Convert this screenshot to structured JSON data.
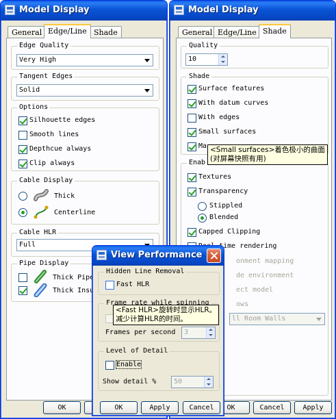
{
  "left_dialog": {
    "title": "Model Display",
    "tabs": [
      "General",
      "Edge/Line",
      "Shade"
    ],
    "edge_quality": {
      "label": "Edge Quality",
      "value": "Very High"
    },
    "tangent_edges": {
      "label": "Tangent Edges",
      "value": "Solid"
    },
    "options": {
      "label": "Options",
      "items": [
        {
          "label": "Silhouette edges",
          "checked": true
        },
        {
          "label": "Smooth lines",
          "checked": false
        },
        {
          "label": "Depthcue always",
          "checked": true
        },
        {
          "label": "Clip always",
          "checked": true
        }
      ]
    },
    "cable_display": {
      "label": "Cable Display",
      "thick": "Thick",
      "centerline": "Centerline",
      "selected": "Centerline"
    },
    "cable_hlr": {
      "label": "Cable HLR",
      "value": "Full"
    },
    "pipe_display": {
      "label": "Pipe Display",
      "thick_pipes": "Thick Pipe",
      "thick_insulation": "Thick Insu"
    },
    "ok": "OK"
  },
  "right_dialog": {
    "title": "Model Display",
    "tabs": [
      "General",
      "Edge/Line",
      "Shade"
    ],
    "quality": {
      "label": "Quality",
      "value": "10"
    },
    "shade": {
      "label": "Shade",
      "items": [
        {
          "label": "Surface features",
          "checked": true
        },
        {
          "label": "With datum curves",
          "checked": true
        },
        {
          "label": "With edges",
          "checked": false
        },
        {
          "label": "Small surfaces",
          "checked": true
        },
        {
          "label": "Ma",
          "checked": true
        }
      ]
    },
    "enable_label": "Enab",
    "enable_items": [
      {
        "label": "Textures",
        "checked": true
      },
      {
        "label": "Transparency",
        "checked": true
      }
    ],
    "stippled": "Stippled",
    "blended": "Blended",
    "capped_clipping": "Capped Clipping",
    "realtime_rendering": "Real-time rendering",
    "environment_mapping": "onment mapping",
    "shade_environment": "de environment",
    "reflect_model": "ect model",
    "shadows": "ows",
    "room_walls": "ll Room Walls",
    "ok": "OK",
    "cancel": "Cancel",
    "apply": "Apply",
    "tooltip_small_surfaces": [
      "<Small surfaces>着色极小的曲面",
      "(对屏幕快照有用)"
    ]
  },
  "view_performance": {
    "title": "View Performance",
    "hidden_line_removal": {
      "label": "Hidden Line Removal",
      "fast_hlr": "Fast HLR"
    },
    "frame_rate": {
      "label": "Frame rate while spinning",
      "frames_per_second_label": "Frames per second",
      "frames_per_second_value": "3"
    },
    "level_of_detail": {
      "label": "Level of Detail",
      "enable": "Enable",
      "show_detail_label": "Show detail %",
      "show_detail_value": "50"
    },
    "ok": "OK",
    "apply": "Apply",
    "cancel": "Cancel",
    "tooltip_fast_hlr": [
      "<Fast HLR>旋转时显示HLR。",
      "减少计算HLR的时间。"
    ]
  },
  "colors": {
    "title_bar": "#0854d4",
    "dialog_bg": "#ece9d8",
    "tooltip_bg": "#ffffe1",
    "check_green": "#21a121"
  }
}
